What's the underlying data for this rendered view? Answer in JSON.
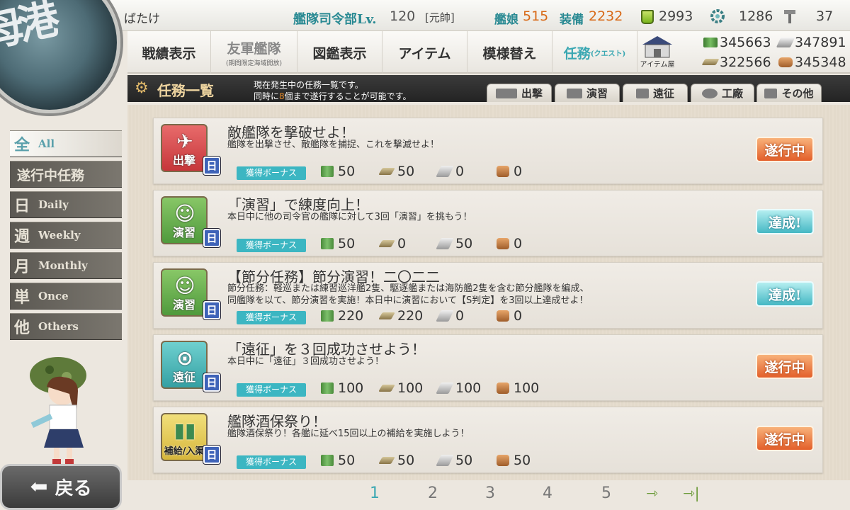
{
  "top": {
    "admiral_name": "ばたけ",
    "rank_label": "艦隊司令部Lv.",
    "rank_level": "120",
    "rank_title": "[元帥]",
    "ship_label": "艦娘",
    "ship_count": "515",
    "equip_label": "装備",
    "equip_count": "2232",
    "bucket_count": "2993",
    "devmat_count": "1286",
    "screw_count": "37"
  },
  "emblem": {
    "text": "母港"
  },
  "menu": {
    "record": "戦績表示",
    "friend": "友軍艦隊",
    "friend_sub": "(期間限定海域開放)",
    "library": "図鑑表示",
    "items": "アイテム",
    "furniture": "模様替え",
    "quest": "任務",
    "quest_sub": "(クエスト)",
    "item_shop": "アイテム屋"
  },
  "resources": {
    "fuel": "345663",
    "ammo": "322566",
    "steel": "347891",
    "bauxite": "345348"
  },
  "header": {
    "title": "任務一覧",
    "desc1": "現在発生中の任務一覧です。",
    "desc2_pre": "同時に",
    "desc2_num": "8",
    "desc2_post": "個まで遂行することが可能です。"
  },
  "category_tabs": [
    "出撃",
    "演習",
    "遠征",
    "工廠",
    "その他"
  ],
  "filters": [
    {
      "kanji": "全",
      "en": "All"
    },
    {
      "label": "遂行中任務"
    },
    {
      "kanji": "日",
      "en": "Daily"
    },
    {
      "kanji": "週",
      "en": "Weekly"
    },
    {
      "kanji": "月",
      "en": "Monthly"
    },
    {
      "kanji": "単",
      "en": "Once"
    },
    {
      "kanji": "他",
      "en": "Others"
    }
  ],
  "bonus_label": "獲得ボーナス",
  "daily_mark": "日",
  "quests": [
    {
      "category": "出撃",
      "title": "敵艦隊を撃破せよ！",
      "desc": [
        "艦隊を出撃させ、敵艦隊を捕捉、これを撃滅せよ！"
      ],
      "rewards": {
        "fuel": "50",
        "ammo": "50",
        "steel": "0",
        "bauxite": "0"
      },
      "status": "遂行中"
    },
    {
      "category": "演習",
      "title": "「演習」で練度向上！",
      "desc": [
        "本日中に他の司令官の艦隊に対して3回「演習」を挑もう！"
      ],
      "rewards": {
        "fuel": "50",
        "ammo": "0",
        "steel": "50",
        "bauxite": "0"
      },
      "status": "達成!"
    },
    {
      "category": "演習",
      "title": "【節分任務】節分演習！二〇二二",
      "desc": [
        "節分任務：軽巡または練習巡洋艦2隻、駆逐艦または海防艦2隻を含む節分艦隊を編成、",
        "同艦隊を以て、節分演習を実施！本日中に演習において【S判定】を3回以上達成せよ！"
      ],
      "rewards": {
        "fuel": "220",
        "ammo": "220",
        "steel": "0",
        "bauxite": "0"
      },
      "status": "達成!"
    },
    {
      "category": "遠征",
      "title": "「遠征」を３回成功させよう！",
      "desc": [
        "本日中に「遠征」３回成功させよう！"
      ],
      "rewards": {
        "fuel": "100",
        "ammo": "100",
        "steel": "100",
        "bauxite": "100"
      },
      "status": "遂行中"
    },
    {
      "category": "補給/入渠",
      "title": "艦隊酒保祭り！",
      "desc": [
        "艦隊酒保祭り！各艦に延べ15回以上の補給を実施しよう！"
      ],
      "rewards": {
        "fuel": "50",
        "ammo": "50",
        "steel": "50",
        "bauxite": "50"
      },
      "status": "遂行中"
    }
  ],
  "pagination": {
    "pages": [
      "1",
      "2",
      "3",
      "4",
      "5"
    ],
    "current": "1"
  },
  "back_label": "戻る"
}
